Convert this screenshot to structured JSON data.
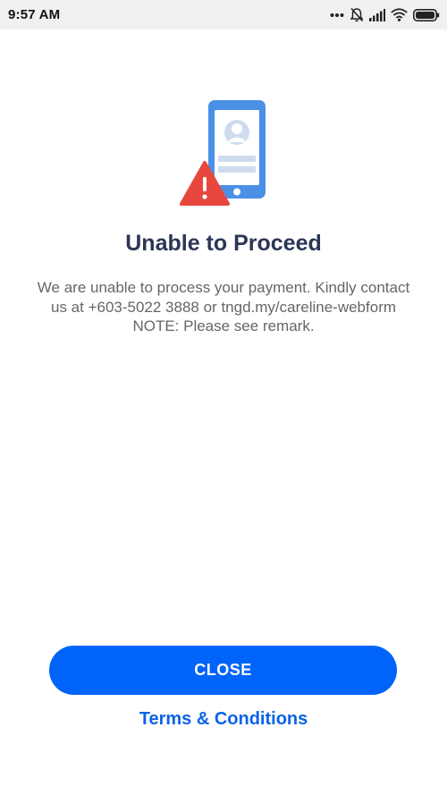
{
  "status_bar": {
    "time": "9:57 AM",
    "icons": [
      "more-dots-icon",
      "bell-off-icon",
      "signal-icon",
      "wifi-icon",
      "battery-icon"
    ]
  },
  "illustration": {
    "icon": "phone-profile-warning-icon",
    "colors": {
      "phone": "#4a90e6",
      "card": "#cfdcef",
      "warning": "#e8473d"
    }
  },
  "dialog": {
    "title": "Unable to Proceed",
    "message": "We are unable to process your payment. Kindly contact us at +603-5022 3888 or tngd.my/careline-webform NOTE: Please see remark."
  },
  "actions": {
    "close_label": "CLOSE",
    "terms_label": "Terms & Conditions"
  },
  "colors": {
    "primary": "#0064fa",
    "title": "#2c3555",
    "body_text": "#666666",
    "link": "#0b63e6"
  }
}
